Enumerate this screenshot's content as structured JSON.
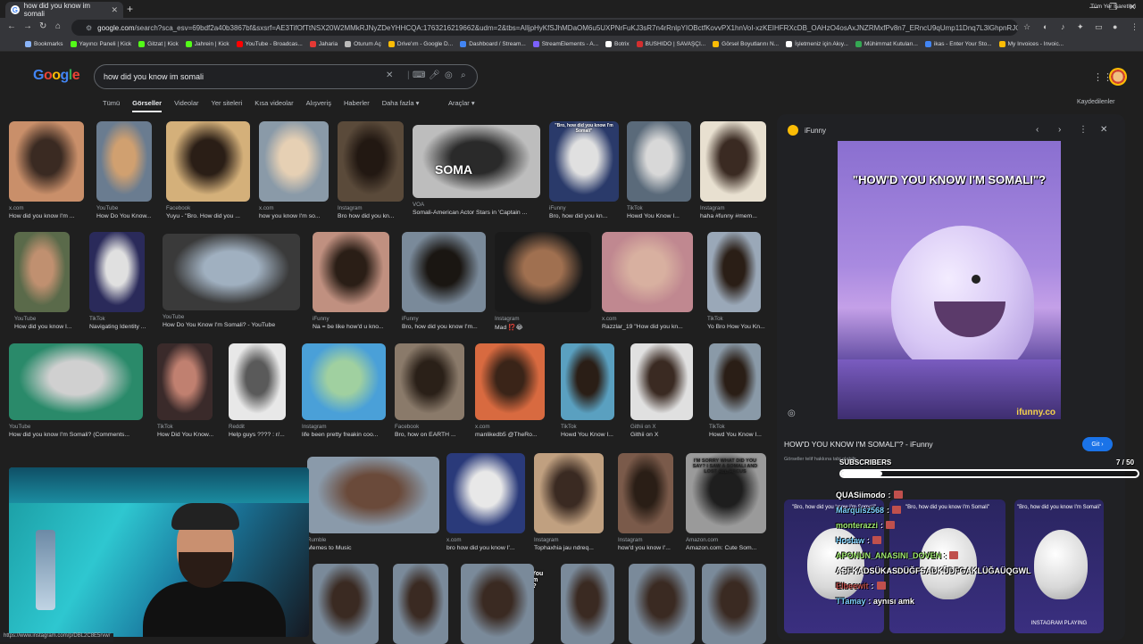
{
  "browser": {
    "tab_title": "how did you know im somali",
    "tab_favicon": "G",
    "url_domain": "google.com",
    "url_rest": "/search?sca_esv=69bdf2a40b3867bf&sxsrf=AE3TifOfTtNSX20W2MMkRJNyZDeYHHCQA:1763216219662&udm=2&tbs=AIljpHyKfSJhMDaOM6u5UXPNrFuKJ3sR7n4rRnlpYIOBctfKovvPX1hnVoI-xzKEIHFRXcDB_OAHzO4osAxJNZRMxfPv8n7_ERncU9qUmp11Dnq7L3lGhpnRJQyk12xtvSkGF0MoYyGly9QZgKeKWeyV3Fdf4VvioTw...",
    "bookmarks": [
      {
        "label": "Bookmarks",
        "color": "#8ab4f8"
      },
      {
        "label": "Yayıncı Paneli | Kick",
        "color": "#53fc18"
      },
      {
        "label": "Gitzat | Kick",
        "color": "#53fc18"
      },
      {
        "label": "Jahrein | Kick",
        "color": "#53fc18"
      },
      {
        "label": "YouTube - Broadcas...",
        "color": "#ff0000"
      },
      {
        "label": "Jaharia",
        "color": "#e53935"
      },
      {
        "label": "Oturum Aç",
        "color": "#bbbbbb"
      },
      {
        "label": "Drive'ım - Google D...",
        "color": "#fbbc05"
      },
      {
        "label": "Dashboard / Stream...",
        "color": "#4285f4"
      },
      {
        "label": "StreamElements - A...",
        "color": "#7b61ff"
      },
      {
        "label": "Botrix",
        "color": "#ffffff"
      },
      {
        "label": "BUSHIDO | SAVAŞÇI...",
        "color": "#d32f2f"
      },
      {
        "label": "Görsel Boyutlarını N...",
        "color": "#fbbc05"
      },
      {
        "label": "İşletmeniz için Akıy...",
        "color": "#ffffff"
      },
      {
        "label": "Mühimmat Kutuları...",
        "color": "#34a853"
      },
      {
        "label": "ikas - Enter Your Sto...",
        "color": "#4285f4"
      },
      {
        "label": "My Invoices - Invoic...",
        "color": "#fbbc05"
      }
    ],
    "bookmarks_all": "Tüm Yer İşaretleri"
  },
  "google": {
    "logo": "Google",
    "query": "how did you know im somali",
    "tabs": [
      "Tümü",
      "Görseller",
      "Videolar",
      "Yer siteleri",
      "Kısa videolar",
      "Alışveriş",
      "Haberler",
      "Daha fazla ▾"
    ],
    "active_tab": "Görseller",
    "tools": "Araçlar ▾",
    "saved": "Kaydedilenler"
  },
  "results": [
    {
      "src": "x.com",
      "title": "How did you know I'm ..."
    },
    {
      "src": "YouTube",
      "title": "How Do You Know..."
    },
    {
      "src": "Facebook",
      "title": "Yuyu - \"Bro. How did you ..."
    },
    {
      "src": "x.com",
      "title": "how you know I'm so..."
    },
    {
      "src": "Instagram",
      "title": "Bro how did you kn..."
    },
    {
      "src": "VOA",
      "title": "Somali-American Actor Stars in 'Captain ..."
    },
    {
      "src": "iFunny",
      "title": "Bro, how did you kn..."
    },
    {
      "src": "TikTok",
      "title": "Howd You Know I..."
    },
    {
      "src": "Instagram",
      "title": "haha #funny #mem..."
    },
    {
      "src": "YouTube",
      "title": "How did you know I..."
    },
    {
      "src": "TikTok",
      "title": "Navigating Identity ..."
    },
    {
      "src": "YouTube",
      "title": "How Do You Know I'm Somali? - YouTube"
    },
    {
      "src": "iFunny",
      "title": "Na = be like how'd u kno..."
    },
    {
      "src": "iFunny",
      "title": "Bro, how did you know I'm..."
    },
    {
      "src": "Instagram",
      "title": "Mad ⁉️😂"
    },
    {
      "src": "x.com",
      "title": "Razzlar_19 \"How did you kn..."
    },
    {
      "src": "TikTok",
      "title": "Yo Bro How You Kn..."
    },
    {
      "src": "YouTube",
      "title": "How did you know I'm Somali? (Comments..."
    },
    {
      "src": "TikTok",
      "title": "How Did You Know..."
    },
    {
      "src": "Reddit",
      "title": "Help guys ???? : r/..."
    },
    {
      "src": "Instagram",
      "title": "life been pretty freakin coo..."
    },
    {
      "src": "Facebook",
      "title": "Bro, how on EARTH ..."
    },
    {
      "src": "x.com",
      "title": "manlikedb5 @TheRo..."
    },
    {
      "src": "TikTok",
      "title": "Howd You Know I..."
    },
    {
      "src": "Githii on X",
      "title": "Githii on X"
    },
    {
      "src": "TikTok",
      "title": "Howd You Know I..."
    },
    {
      "src": "Rumble",
      "title": "Memes to Music"
    },
    {
      "src": "x.com",
      "title": "bro how did you know I'..."
    },
    {
      "src": "Instagram",
      "title": "Tophaxhia jau ndreq..."
    },
    {
      "src": "Instagram",
      "title": "how'd you know I'..."
    },
    {
      "src": "Amazon.com",
      "title": "Amazon.com: Cute Som..."
    }
  ],
  "thumb_texts": {
    "soma": "SOMA",
    "bro_skull": "\"Bro, how did you know I'm Somali\"",
    "sorry_sign": "I'M SORRY WHAT DID YOU SAY? I SAW A SOMALI AND LOST ALL FOCUS",
    "did_you_know": "How Did You Know I'm Somali?",
    "instagram_playing": "INSTAGRAM PLAYING"
  },
  "panel": {
    "source": "iFunny",
    "image_caption": "\"HOW'D YOU KNOW I'M SOMALI\"?",
    "watermark": "ifunny.co",
    "title": "HOW'D YOU KNOW I'M SOMALI\"? - iFunny",
    "visit": "Git ›",
    "note": "Görseller telif hakkına tabi olabilir.",
    "related_text": "\"Bro, how did you know I'm Somali\""
  },
  "overlay": {
    "subs_label": "SUBSCRIBERS",
    "subs_count": "7 / 50",
    "subs_progress": 0.14,
    "chat": [
      {
        "user": "QUASiimodo",
        "msg": ":",
        "color": "#ffffff"
      },
      {
        "user": "Marquisz568",
        "msg": ":",
        "color": "#7fd3ff"
      },
      {
        "user": "monterazzi",
        "msg": ":",
        "color": "#9fe870"
      },
      {
        "user": "Hostaw",
        "msg": ":",
        "color": "#7fd3ff"
      },
      {
        "user": "APONUN_ANASINI_DOVEN",
        "msg": ":",
        "color": "#9fe870"
      },
      {
        "user": "",
        "msg": "ASFKADSÜKASDÜĞFSADKÜDFGAKLÜĞAÜQGWL",
        "color": "#ffffff"
      },
      {
        "user": "Elbeewit",
        "msg": ":",
        "color": "#c0504d"
      },
      {
        "user": "TTamay",
        "msg": ": aynısı amk",
        "color": "#7fd3ff"
      }
    ]
  },
  "status_url": "https://www.instagram.com/p/DBL2C8E5rvw/"
}
